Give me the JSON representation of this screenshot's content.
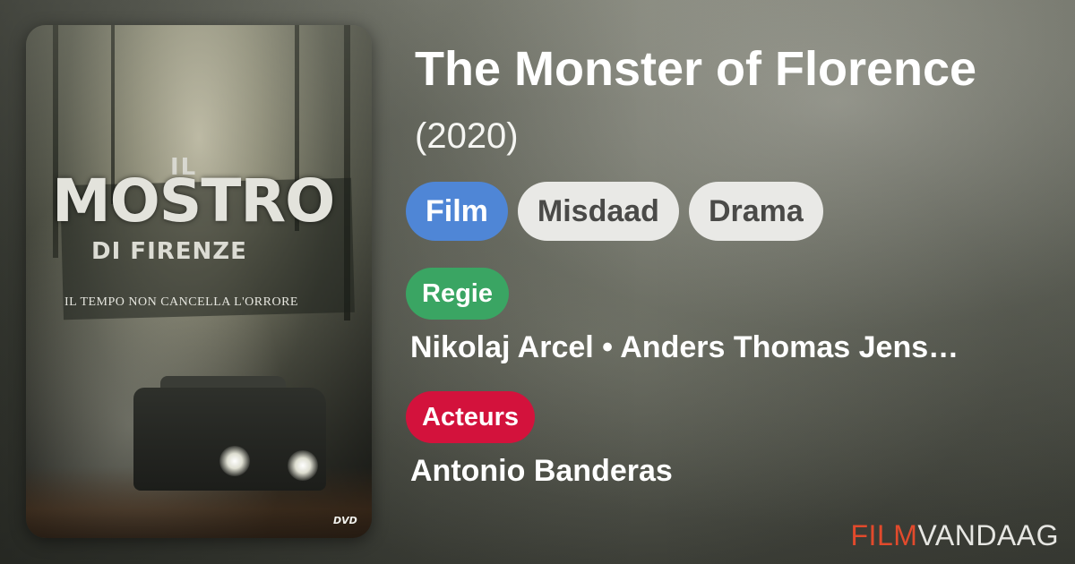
{
  "movie": {
    "title": "The Monster of Florence",
    "year": "(2020)"
  },
  "poster": {
    "il": "IL",
    "mostro": "MOSTRO",
    "firenze": "DI FIRENZE",
    "tagline": "IL TEMPO NON CANCELLA L'ORRORE",
    "dvd": "DVD"
  },
  "chips": {
    "type": "Film",
    "genre1": "Misdaad",
    "genre2": "Drama"
  },
  "sections": {
    "regie_label": "Regie",
    "regie_names": "Nikolaj Arcel • Anders Thomas Jens…",
    "actors_label": "Acteurs",
    "actors_names": "Antonio Banderas"
  },
  "brand": {
    "part1": "FILM",
    "part2": "VANDAAG"
  },
  "colors": {
    "film_chip": "#4f86d6",
    "genre_chip": "#e9e9e6",
    "regie_badge": "#3aa563",
    "actors_badge": "#d3123c",
    "brand_accent": "#e24a2c"
  }
}
